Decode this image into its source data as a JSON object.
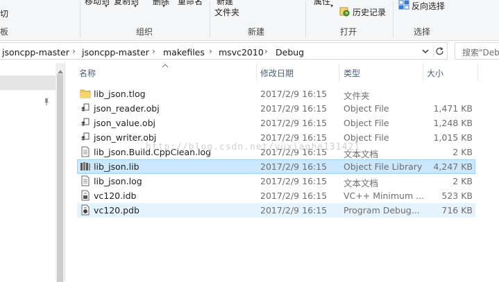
{
  "ribbon": {
    "clipboard_fragment": "切",
    "clipboard_fragment2": "板",
    "move_to": "移动到",
    "copy_to": "复制到",
    "delete": "删除",
    "rename": "重命名",
    "new_item_top": "新建",
    "new_folder": "文件夹",
    "properties": "属性",
    "history": "历史记录",
    "invert_selection": "反向选择",
    "groups": {
      "organize": "组织",
      "new": "新建",
      "open": "打开",
      "select": "选择"
    }
  },
  "address": {
    "crumbs": [
      "jsoncpp-master",
      "jsoncpp-master",
      "makefiles",
      "msvc2010",
      "Debug"
    ],
    "search_placeholder": "搜索\"Debug\""
  },
  "columns": {
    "name": "名称",
    "date": "修改日期",
    "type": "类型",
    "size": "大小"
  },
  "files": [
    {
      "icon": "folder-icon",
      "name": "lib_json.tlog",
      "date": "2017/2/9 16:15",
      "type": "文件夹",
      "size": ""
    },
    {
      "icon": "obj-file-icon",
      "name": "json_reader.obj",
      "date": "2017/2/9 16:15",
      "type": "Object File",
      "size": "1,471 KB"
    },
    {
      "icon": "obj-file-icon",
      "name": "json_value.obj",
      "date": "2017/2/9 16:15",
      "type": "Object File",
      "size": "1,248 KB"
    },
    {
      "icon": "obj-file-icon",
      "name": "json_writer.obj",
      "date": "2017/2/9 16:15",
      "type": "Object File",
      "size": "1,015 KB"
    },
    {
      "icon": "text-file-icon",
      "name": "lib_json.Build.CppClean.log",
      "date": "2017/2/9 16:15",
      "type": "文本文档",
      "size": "2 KB"
    },
    {
      "icon": "library-file-icon",
      "name": "lib_json.lib",
      "date": "2017/2/9 16:15",
      "type": "Object File Library",
      "size": "4,247 KB"
    },
    {
      "icon": "text-file-icon",
      "name": "lib_json.log",
      "date": "2017/2/9 16:15",
      "type": "文本文档",
      "size": "2 KB"
    },
    {
      "icon": "idb-file-icon",
      "name": "vc120.idb",
      "date": "2017/2/9 16:15",
      "type": "VC++ Minimum ...",
      "size": "523 KB"
    },
    {
      "icon": "pdb-file-icon",
      "name": "vc120.pdb",
      "date": "2017/2/9 16:15",
      "type": "Program Debug...",
      "size": "716 KB"
    }
  ],
  "watermark": "http://blog.csdn.net/yuxiaohe131421",
  "colors": {
    "selection_bg": "#cce8ff",
    "selection_border": "#99d1ff",
    "hover_bg": "#e5f3ff",
    "header_text": "#4c607a",
    "folder": "#f3c74d"
  }
}
